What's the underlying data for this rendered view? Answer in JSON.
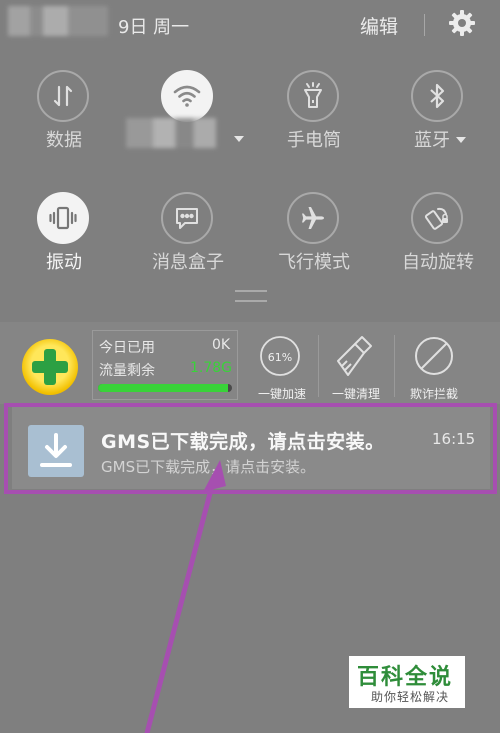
{
  "status_bar": {
    "date": "9日 周一",
    "edit": "编辑"
  },
  "quick_settings": {
    "row1": [
      {
        "label": "数据",
        "icon": "data-toggle-icon",
        "on": false
      },
      {
        "label": "",
        "icon": "wifi-icon",
        "on": true
      },
      {
        "label": "手电筒",
        "icon": "flashlight-icon",
        "on": false
      },
      {
        "label": "蓝牙",
        "icon": "bluetooth-icon",
        "on": false
      }
    ],
    "row2": [
      {
        "label": "振动",
        "icon": "vibrate-icon",
        "on": true
      },
      {
        "label": "消息盒子",
        "icon": "message-box-icon",
        "on": false
      },
      {
        "label": "飞行模式",
        "icon": "airplane-icon",
        "on": false
      },
      {
        "label": "自动旋转",
        "icon": "auto-rotate-icon",
        "on": false
      }
    ]
  },
  "security_widget": {
    "today_used_label": "今日已用",
    "today_used_value": "0K",
    "remaining_label": "流量剩余",
    "remaining_value": "1.78G",
    "remaining_bar_fraction": 0.97,
    "accelerate_percent": "61%",
    "accelerate_label": "一键加速",
    "clean_label": "一键清理",
    "fraud_block_label": "欺诈拦截"
  },
  "notification": {
    "title": "GMS已下载完成，请点击安装。",
    "subtitle": "GMS已下载完成，请点击安装。",
    "time": "16:15"
  },
  "watermark": {
    "main": "百科全说",
    "sub": "助你轻松解决"
  },
  "colors": {
    "highlight": "#a64fb0",
    "progress": "#39d339",
    "logo_green": "#2ca043"
  }
}
